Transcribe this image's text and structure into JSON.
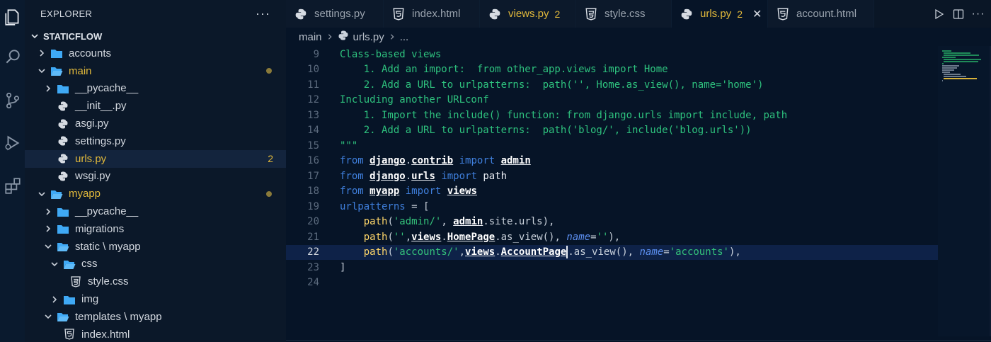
{
  "explorer": {
    "title": "EXPLORER",
    "more": "···",
    "project": "STATICFLOW",
    "tree": [
      {
        "label": "accounts",
        "indent": 0,
        "kind": "folder",
        "state": "collapsed"
      },
      {
        "label": "main",
        "indent": 0,
        "kind": "folder-open",
        "state": "expanded",
        "modified": true,
        "dot": true
      },
      {
        "label": "__pycache__",
        "indent": 1,
        "kind": "folder",
        "state": "collapsed"
      },
      {
        "label": "__init__.py",
        "indent": 1,
        "kind": "python"
      },
      {
        "label": "asgi.py",
        "indent": 1,
        "kind": "python"
      },
      {
        "label": "settings.py",
        "indent": 1,
        "kind": "python"
      },
      {
        "label": "urls.py",
        "indent": 1,
        "kind": "python",
        "modified": true,
        "badge": "2",
        "active": true
      },
      {
        "label": "wsgi.py",
        "indent": 1,
        "kind": "python"
      },
      {
        "label": "myapp",
        "indent": 0,
        "kind": "folder-open",
        "state": "expanded",
        "modified": true,
        "dot": true
      },
      {
        "label": "__pycache__",
        "indent": 1,
        "kind": "folder",
        "state": "collapsed"
      },
      {
        "label": "migrations",
        "indent": 1,
        "kind": "folder",
        "state": "collapsed"
      },
      {
        "label": "static \\ myapp",
        "indent": 1,
        "kind": "folder-open",
        "state": "expanded"
      },
      {
        "label": "css",
        "indent": 2,
        "kind": "folder-open",
        "state": "expanded"
      },
      {
        "label": "style.css",
        "indent": 3,
        "kind": "css"
      },
      {
        "label": "img",
        "indent": 2,
        "kind": "folder",
        "state": "collapsed"
      },
      {
        "label": "templates \\ myapp",
        "indent": 1,
        "kind": "folder-open",
        "state": "expanded"
      },
      {
        "label": "index.html",
        "indent": 2,
        "kind": "html"
      }
    ]
  },
  "tabs": [
    {
      "label": "settings.py",
      "icon": "python",
      "width": 138
    },
    {
      "label": "index.html",
      "icon": "html",
      "width": 136
    },
    {
      "label": "views.py",
      "icon": "python",
      "modified": true,
      "badge": "2",
      "width": 136
    },
    {
      "label": "style.css",
      "icon": "css",
      "width": 135
    },
    {
      "label": "urls.py",
      "icon": "python",
      "modified": true,
      "badge": "2",
      "active": true,
      "close": "✕",
      "width": 136
    },
    {
      "label": "account.html",
      "icon": "html",
      "width": 150
    }
  ],
  "breadcrumb": {
    "root": "main",
    "file": "urls.py",
    "more": "..."
  },
  "editor": {
    "current_line": 22,
    "lines": [
      {
        "n": "9",
        "tokens": [
          [
            "c-cm",
            "Class-based views"
          ]
        ]
      },
      {
        "n": "10",
        "tokens": [
          [
            "c-cm",
            "    1. Add an import:  from other_app.views import Home"
          ]
        ]
      },
      {
        "n": "11",
        "tokens": [
          [
            "c-cm",
            "    2. Add a URL to urlpatterns:  path('', Home.as_view(), name='home')"
          ]
        ]
      },
      {
        "n": "12",
        "tokens": [
          [
            "c-cm",
            "Including another URLconf"
          ]
        ]
      },
      {
        "n": "13",
        "tokens": [
          [
            "c-cm",
            "    1. Import the include() function: from django.urls import include, path"
          ]
        ]
      },
      {
        "n": "14",
        "tokens": [
          [
            "c-cm",
            "    2. Add a URL to urlpatterns:  path('blog/', include('blog.urls'))"
          ]
        ]
      },
      {
        "n": "15",
        "tokens": [
          [
            "c-cm",
            "\"\"\""
          ]
        ]
      },
      {
        "n": "16",
        "tokens": [
          [
            "c-kw",
            "from "
          ],
          [
            "c-bold",
            "django"
          ],
          [
            "c-op",
            "."
          ],
          [
            "c-bold",
            "contrib"
          ],
          [
            "c-kw",
            " import "
          ],
          [
            "c-bold",
            "admin"
          ]
        ]
      },
      {
        "n": "17",
        "tokens": [
          [
            "c-kw",
            "from "
          ],
          [
            "c-bold",
            "django"
          ],
          [
            "c-op",
            "."
          ],
          [
            "c-bold",
            "urls"
          ],
          [
            "c-kw",
            " import "
          ],
          [
            "c-id",
            "path"
          ]
        ]
      },
      {
        "n": "18",
        "tokens": [
          [
            "c-kw",
            "from "
          ],
          [
            "c-bold",
            "myapp"
          ],
          [
            "c-kw",
            " import "
          ],
          [
            "c-bold",
            "views"
          ]
        ]
      },
      {
        "n": "19",
        "tokens": [
          [
            "c-kw",
            "urlpatterns"
          ],
          [
            "c-op",
            " = ["
          ]
        ]
      },
      {
        "n": "20",
        "tokens": [
          [
            "c-fn",
            "    path"
          ],
          [
            "c-op",
            "("
          ],
          [
            "c-str",
            "'admin/'"
          ],
          [
            "c-op",
            ", "
          ],
          [
            "c-bold",
            "admin"
          ],
          [
            "c-op",
            ".site.urls),"
          ]
        ]
      },
      {
        "n": "21",
        "tokens": [
          [
            "c-fn",
            "    path"
          ],
          [
            "c-op",
            "("
          ],
          [
            "c-str",
            "''"
          ],
          [
            "c-op",
            ","
          ],
          [
            "c-bold",
            "views"
          ],
          [
            "c-op",
            "."
          ],
          [
            "c-bold",
            "HomePage"
          ],
          [
            "c-op",
            ".as_view(), "
          ],
          [
            "c-param",
            "name"
          ],
          [
            "c-op",
            "="
          ],
          [
            "c-str",
            "''"
          ],
          [
            "c-op",
            "),"
          ]
        ]
      },
      {
        "n": "22",
        "tokens": [
          [
            "c-fn",
            "    path"
          ],
          [
            "c-op",
            "("
          ],
          [
            "c-str",
            "'accounts/'"
          ],
          [
            "c-op",
            ","
          ],
          [
            "c-bold",
            "views"
          ],
          [
            "c-op",
            "."
          ],
          [
            "c-bold",
            "AccountPage"
          ],
          [
            "cursor",
            ""
          ],
          [
            "c-op",
            ".as_view(), "
          ],
          [
            "c-param",
            "name"
          ],
          [
            "c-op",
            "="
          ],
          [
            "c-str",
            "'accounts'"
          ],
          [
            "c-op",
            "),"
          ]
        ]
      },
      {
        "n": "23",
        "tokens": [
          [
            "c-op",
            "]"
          ]
        ]
      },
      {
        "n": "24",
        "tokens": []
      }
    ]
  },
  "colors": {
    "accent_modified": "#e2b93b",
    "folder_blue": "#3fa9f5",
    "python_blue": "#3b77c9",
    "comment_green": "#2ec27e",
    "keyword_blue": "#3f7fdc"
  }
}
